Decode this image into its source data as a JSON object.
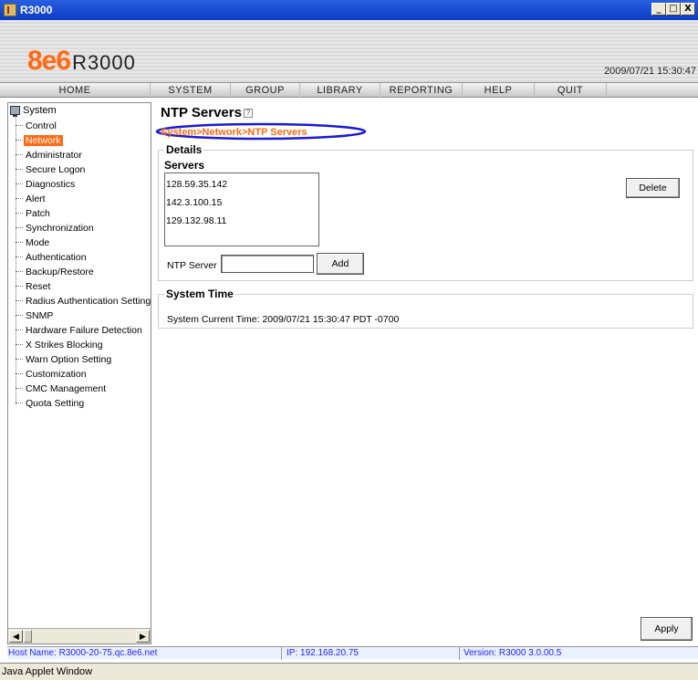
{
  "window": {
    "title": "R3000",
    "controls": [
      "_",
      "□",
      "X"
    ]
  },
  "header": {
    "logo_brand": "8e6",
    "logo_product": "R3000",
    "datetime": "2009/07/21 15:30:47"
  },
  "nav": {
    "items": [
      {
        "label": "HOME"
      },
      {
        "label": "SYSTEM"
      },
      {
        "label": "GROUP"
      },
      {
        "label": "LIBRARY"
      },
      {
        "label": "REPORTING"
      },
      {
        "label": "HELP"
      },
      {
        "label": "QUIT"
      }
    ]
  },
  "sidebar": {
    "root": "System",
    "selected": "Network",
    "items": [
      "Control",
      "Network",
      "Administrator",
      "Secure Logon",
      "Diagnostics",
      "Alert",
      "Patch",
      "Synchronization",
      "Mode",
      "Authentication",
      "Backup/Restore",
      "Reset",
      "Radius Authentication Setting",
      "SNMP",
      "Hardware Failure Detection",
      "X Strikes Blocking",
      "Warn Option Setting",
      "Customization",
      "CMC Management",
      "Quota Setting"
    ]
  },
  "main": {
    "title": "NTP Servers",
    "breadcrumb": "System>Network>NTP Servers",
    "details": {
      "legend": "Details",
      "servers_label": "Servers",
      "servers": [
        "128.59.35.142",
        "142.3.100.15",
        "129.132.98.11"
      ],
      "delete_label": "Delete",
      "ntp_server_label": "NTP Server",
      "ntp_server_value": "",
      "add_label": "Add"
    },
    "system_time": {
      "legend": "System Time",
      "text": "System Current Time:  2009/07/21 15:30:47 PDT -0700"
    },
    "apply_label": "Apply"
  },
  "status": {
    "host": "Host Name: R3000-20-75.qc.8e6.net",
    "ip": "IP: 192.168.20.75",
    "version": "Version: R3000 3.0.00.5"
  },
  "java_bar": "Java Applet Window",
  "colors": {
    "accent_orange": "#ff6a13",
    "annotation_blue": "#1a1ad6",
    "status_text": "#2323ff"
  }
}
